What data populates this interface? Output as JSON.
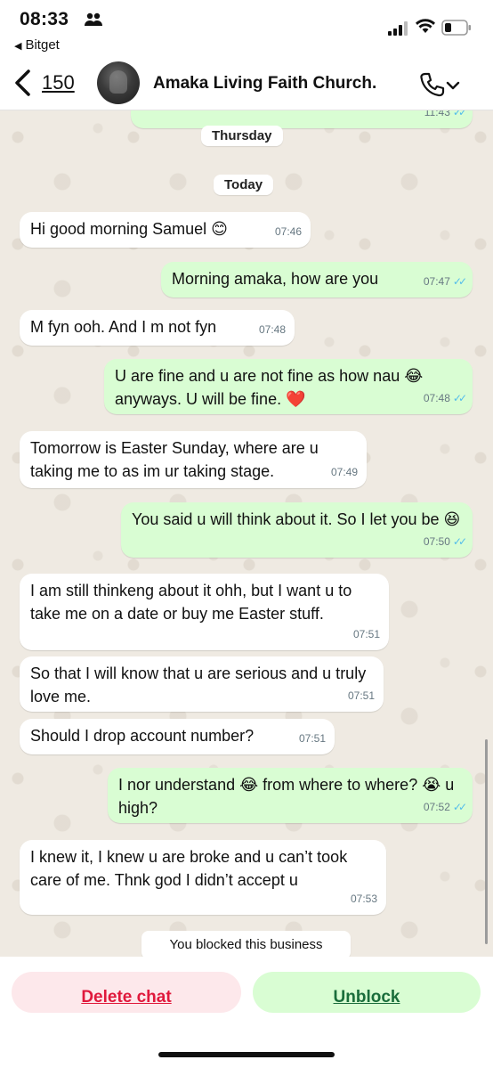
{
  "status_bar": {
    "time": "08:33",
    "back_app": "Bitget"
  },
  "header": {
    "unread_count": "150",
    "title": "Amaka Living Faith Church."
  },
  "chat": {
    "top_partial_time": "11:43",
    "date_thursday": "Thursday",
    "date_today": "Today",
    "messages": [
      {
        "text": "Hi good morning Samuel 😊",
        "time": "07:46",
        "dir": "in"
      },
      {
        "text": "Morning amaka, how are you",
        "time": "07:47",
        "dir": "out"
      },
      {
        "text": "M fyn ooh. And I m not fyn",
        "time": "07:48",
        "dir": "in"
      },
      {
        "text": "U are fine and u are not fine as how nau 😂 anyways. U will be fine. ❤️",
        "time": "07:48",
        "dir": "out"
      },
      {
        "text": "Tomorrow is Easter Sunday, where are u taking me to as im ur taking stage.",
        "time": "07:49",
        "dir": "in"
      },
      {
        "text": "You said u will think about it. So I let  you be 😆",
        "time": "07:50",
        "dir": "out"
      },
      {
        "text": "I am still thinkeng about it ohh, but I want u to take me on a date or buy me Easter stuff.",
        "time": "07:51",
        "dir": "in"
      },
      {
        "text": "So that I will know that u are serious and u truly love me.",
        "time": "07:51",
        "dir": "in"
      },
      {
        "text": "Should I drop account number?",
        "time": "07:51",
        "dir": "in"
      },
      {
        "text": "I nor understand 😂 from where to where? 😭 u high?",
        "time": "07:52",
        "dir": "out"
      },
      {
        "text": "I knew it, I knew u are broke and u can’t took care of me. Thnk god I didn’t accept u",
        "time": "07:53",
        "dir": "in"
      }
    ],
    "notice": "You blocked this business"
  },
  "footer": {
    "delete_label": "Delete chat",
    "unblock_label": "Unblock"
  },
  "colors": {
    "incoming": "#ffffff",
    "outgoing": "#d9fdd3",
    "read_ticks": "#53bdeb",
    "delete": "#e0193c",
    "unblock": "#1a6d3b"
  }
}
